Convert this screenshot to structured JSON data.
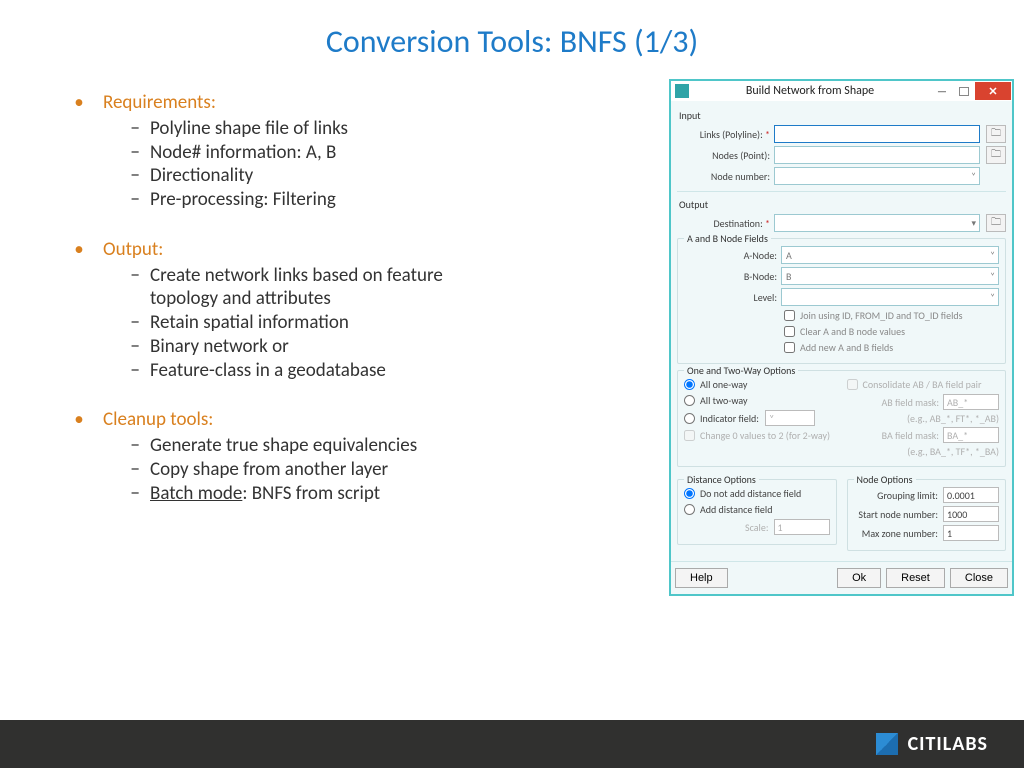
{
  "title": "Conversion Tools: BNFS (1/3)",
  "sections": [
    {
      "head": "Requirements:",
      "items": [
        "Polyline shape file of links",
        "Node# information: A, B",
        "Directionality",
        "Pre-processing: Filtering"
      ]
    },
    {
      "head": "Output:",
      "items": [
        "Create network links based on feature topology and attributes",
        "Retain spatial information",
        "Binary network or",
        "Feature-class in a geodatabase"
      ]
    },
    {
      "head": "Cleanup tools:",
      "items": [
        "Generate true shape equivalencies",
        "Copy shape from another layer",
        {
          "pre": "Batch mode",
          "post": ": BNFS from script"
        }
      ]
    }
  ],
  "dialog": {
    "title": "Build Network from Shape",
    "input": {
      "legend": "Input",
      "links_lbl": "Links (Polyline):",
      "nodes_lbl": "Nodes (Point):",
      "nodenum_lbl": "Node number:"
    },
    "output": {
      "legend": "Output",
      "dest_lbl": "Destination:"
    },
    "ab": {
      "legend": "A and B Node Fields",
      "anode_lbl": "A-Node:",
      "anode_val": "A",
      "bnode_lbl": "B-Node:",
      "bnode_val": "B",
      "level_lbl": "Level:",
      "chk1": "Join using ID, FROM_ID and TO_ID fields",
      "chk2": "Clear A and B node values",
      "chk3": "Add new A and B fields"
    },
    "twoway": {
      "legend": "One and Two-Way Options",
      "opt1": "All one-way",
      "opt2": "All two-way",
      "opt3": "Indicator field:",
      "consol": "Consolidate AB / BA field pair",
      "ab_mask_lbl": "AB field mask:",
      "ab_mask": "AB_*",
      "ab_eg": "(e.g., AB_*, FT*, *_AB)",
      "ba_mask_lbl": "BA field mask:",
      "ba_mask": "BA_*",
      "ba_eg": "(e.g., BA_*, TF*, *_BA)",
      "change0": "Change 0 values to 2 (for 2-way)"
    },
    "dist": {
      "legend": "Distance Options",
      "opt1": "Do not add distance field",
      "opt2": "Add distance field",
      "scale_lbl": "Scale:",
      "scale_val": "1"
    },
    "node": {
      "legend": "Node Options",
      "group_lbl": "Grouping limit:",
      "group_val": "0.0001",
      "start_lbl": "Start node number:",
      "start_val": "1000",
      "max_lbl": "Max zone number:",
      "max_val": "1"
    },
    "buttons": {
      "help": "Help",
      "ok": "Ok",
      "reset": "Reset",
      "close": "Close"
    }
  },
  "footer": {
    "brand": "CITILABS"
  }
}
